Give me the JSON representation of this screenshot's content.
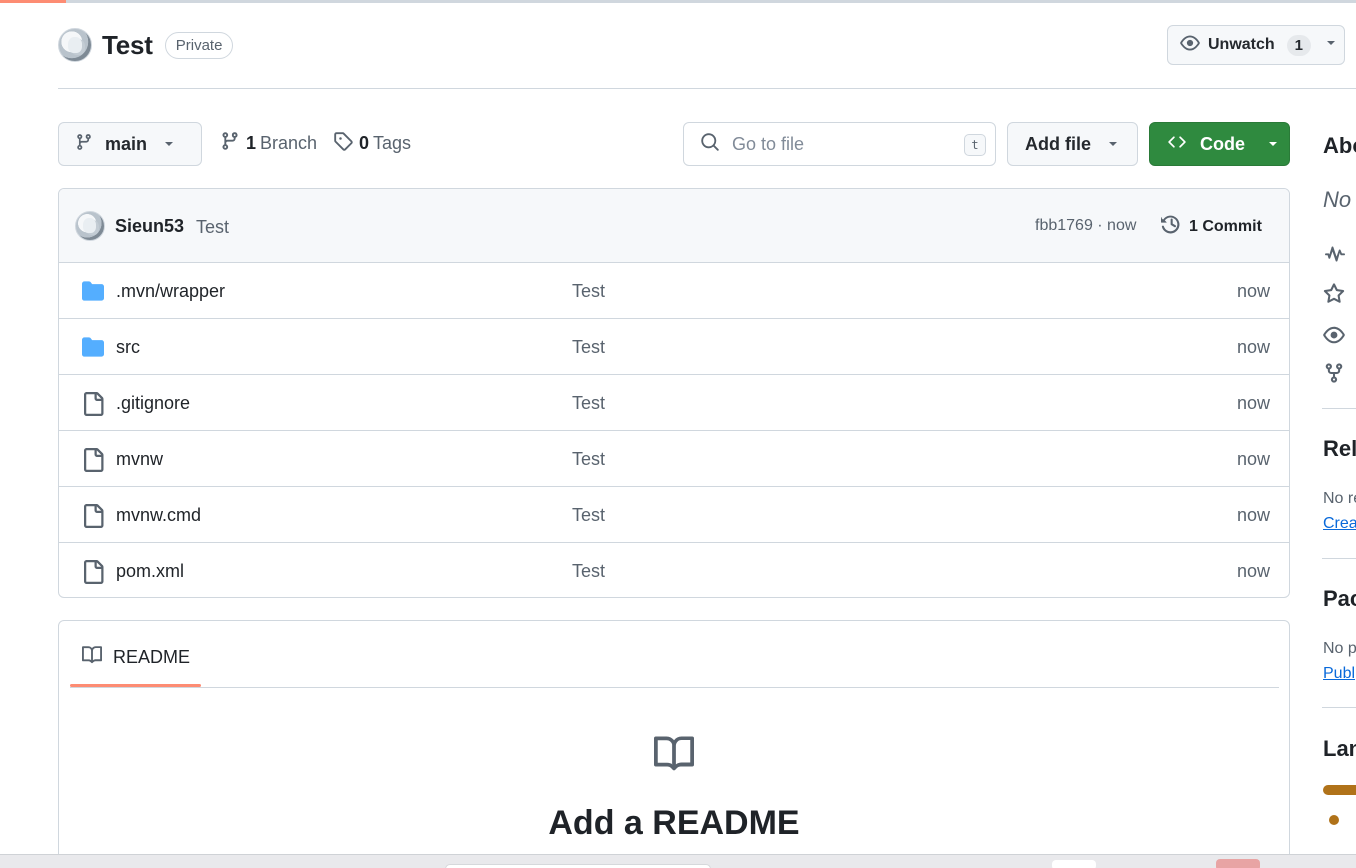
{
  "repo": {
    "name": "Test",
    "visibility": "Private"
  },
  "watch": {
    "label": "Unwatch",
    "count": "1"
  },
  "toolbar": {
    "branch": "main",
    "branches_count": "1",
    "branches_label": "Branch",
    "tags_count": "0",
    "tags_label": "Tags",
    "goto_placeholder": "Go to file",
    "goto_shortcut": "t",
    "add_file": "Add file",
    "code": "Code"
  },
  "latest_commit": {
    "author": "Sieun53",
    "message": "Test",
    "hash_time": "fbb1769 · now",
    "commits": "1 Commit"
  },
  "files": [
    {
      "name": ".mvn/wrapper",
      "type": "folder",
      "message": "Test",
      "age": "now"
    },
    {
      "name": "src",
      "type": "folder",
      "message": "Test",
      "age": "now"
    },
    {
      "name": ".gitignore",
      "type": "file",
      "message": "Test",
      "age": "now"
    },
    {
      "name": "mvnw",
      "type": "file",
      "message": "Test",
      "age": "now"
    },
    {
      "name": "mvnw.cmd",
      "type": "file",
      "message": "Test",
      "age": "now"
    },
    {
      "name": "pom.xml",
      "type": "file",
      "message": "Test",
      "age": "now"
    }
  ],
  "readme": {
    "tab": "README",
    "cta": "Add a README"
  },
  "sidebar": {
    "about": "Abo",
    "description": "No",
    "releases": "Rele",
    "releases_text": "No re",
    "releases_link": "Crea",
    "packages": "Pac",
    "packages_text": "No p",
    "packages_link": "Publ",
    "languages": "Lan"
  },
  "colors": {
    "code_button": "#2f8a3f",
    "folder_icon": "#54aeff",
    "accent_underline": "#fd8c73",
    "language_java": "#b07219"
  }
}
